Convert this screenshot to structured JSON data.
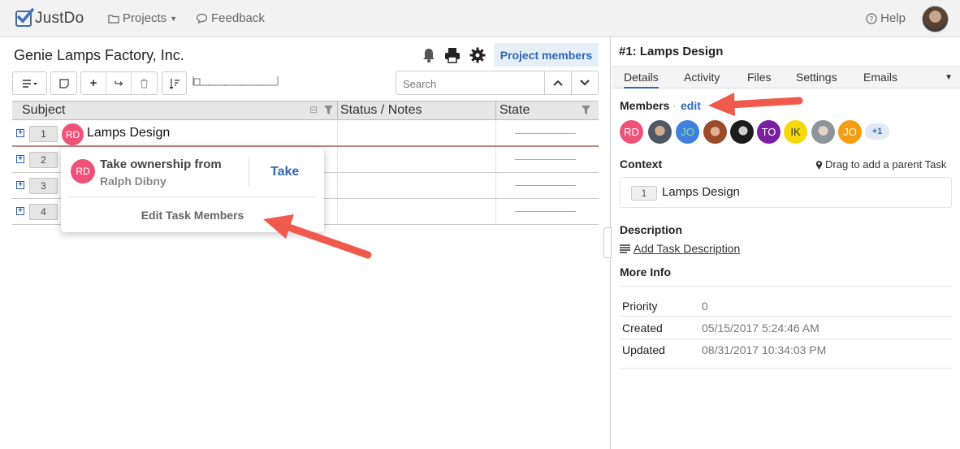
{
  "topnav": {
    "logo_text": "JustDo",
    "projects_label": "Projects",
    "feedback_label": "Feedback",
    "help_label": "Help"
  },
  "project": {
    "title": "Genie Lamps Factory, Inc.",
    "members_button": "Project members"
  },
  "toolbar": {
    "search_placeholder": "Search"
  },
  "grid": {
    "columns": [
      "Subject",
      "Status / Notes",
      "State"
    ],
    "rows": [
      {
        "seq": "1",
        "title": "Lamps Design",
        "owner_initials": "RD"
      },
      {
        "seq": "2",
        "title": ""
      },
      {
        "seq": "3",
        "title": ""
      },
      {
        "seq": "4",
        "title": ""
      }
    ]
  },
  "popover": {
    "avatar_initials": "RD",
    "title": "Take ownership from",
    "from_name": "Ralph Dibny",
    "take_label": "Take",
    "edit_members_label": "Edit Task Members"
  },
  "details": {
    "title": "#1: Lamps Design",
    "tabs": [
      "Details",
      "Activity",
      "Files",
      "Settings",
      "Emails"
    ],
    "members_label": "Members",
    "members_edit": "edit",
    "members": [
      {
        "initials": "RD",
        "color": "#ef5278"
      },
      {
        "initials": "",
        "color": "#6b7d8e"
      },
      {
        "initials": "JO",
        "color": "#3f7fe0",
        "text_color": "#8be37a"
      },
      {
        "initials": "",
        "color": "#b0623e"
      },
      {
        "initials": "",
        "color": "#2a2a2a"
      },
      {
        "initials": "TO",
        "color": "#7a1fa2"
      },
      {
        "initials": "IK",
        "color": "#f5d90a",
        "text_color": "#333333"
      },
      {
        "initials": "",
        "color": "#9aa0a6"
      },
      {
        "initials": "JO",
        "color": "#f59d12"
      }
    ],
    "members_more": "+1",
    "context_label": "Context",
    "drag_hint": "Drag to add a parent Task",
    "context_seq": "1",
    "context_title": "Lamps Design",
    "description_label": "Description",
    "add_description": "Add Task Description",
    "more_info_label": "More Info",
    "info": [
      {
        "key": "Priority",
        "value": "0"
      },
      {
        "key": "Created",
        "value": "05/15/2017 5:24:46 AM"
      },
      {
        "key": "Updated",
        "value": "08/31/2017 10:34:03 PM"
      }
    ]
  },
  "colors": {
    "accent": "#2f68b5",
    "owner_avatar": "#ef5278",
    "annotation_arrow": "#ef5a4c"
  }
}
